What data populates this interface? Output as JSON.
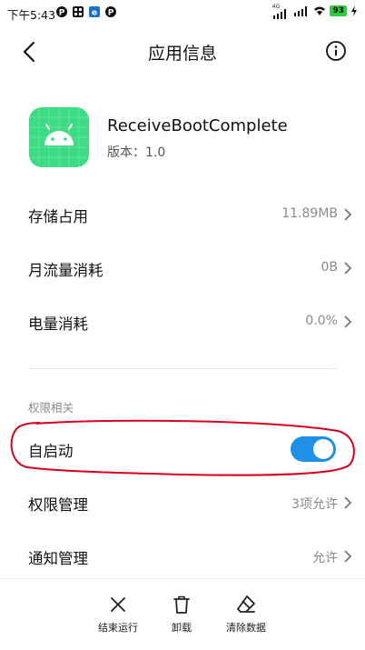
{
  "status_bar": {
    "time": "下午5:43",
    "network_type": "4G",
    "battery": "93"
  },
  "header": {
    "title": "应用信息"
  },
  "app": {
    "name": "ReceiveBootComplete",
    "version": "版本：1.0"
  },
  "rows": [
    {
      "label": "存储占用",
      "value": "11.89MB"
    },
    {
      "label": "月流量消耗",
      "value": "0B"
    },
    {
      "label": "电量消耗",
      "value": "0.0%"
    }
  ],
  "permissions_section": {
    "title": "权限相关",
    "autostart": {
      "label": "自启动",
      "enabled": true
    },
    "permission_manage": {
      "label": "权限管理",
      "value": "3项允许"
    },
    "notification_manage": {
      "label": "通知管理",
      "value": "允许"
    }
  },
  "toolbar": {
    "stop_label": "结束运行",
    "uninstall_label": "卸载",
    "clear_label": "清除数据"
  },
  "colors": {
    "accent": "#1e90e6",
    "app_icon_bg": "#3ddc84",
    "annotation": "#d6001c"
  }
}
